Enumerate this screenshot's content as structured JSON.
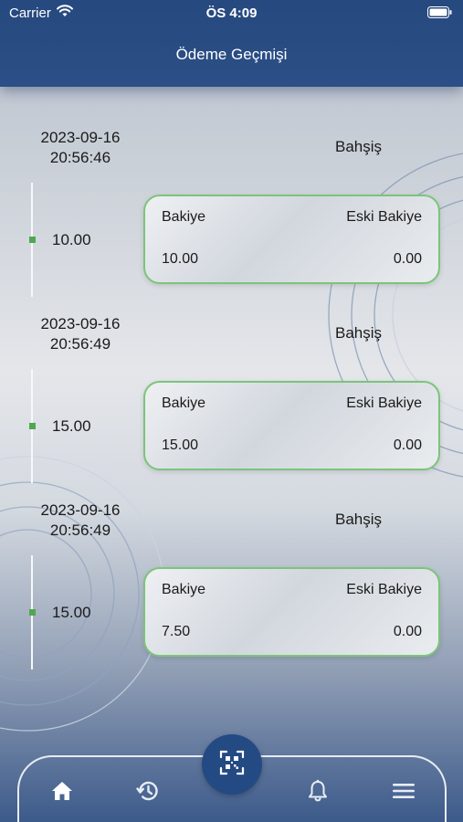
{
  "status_bar": {
    "carrier": "Carrier",
    "time": "ÖS 4:09"
  },
  "header": {
    "title": "Ödeme Geçmişi"
  },
  "entries": [
    {
      "date": "2023-09-16",
      "time": "20:56:46",
      "type": "Bahşiş",
      "amount": "10.00",
      "balance_label": "Bakiye",
      "old_balance_label": "Eski Bakiye",
      "balance": "10.00",
      "old_balance": "0.00"
    },
    {
      "date": "2023-09-16",
      "time": "20:56:49",
      "type": "Bahşiş",
      "amount": "15.00",
      "balance_label": "Bakiye",
      "old_balance_label": "Eski Bakiye",
      "balance": "15.00",
      "old_balance": "0.00"
    },
    {
      "date": "2023-09-16",
      "time": "20:56:49",
      "type": "Bahşiş",
      "amount": "15.00",
      "balance_label": "Bakiye",
      "old_balance_label": "Eski Bakiye",
      "balance": "7.50",
      "old_balance": "0.00"
    }
  ],
  "tab_bar": {
    "items": [
      {
        "icon": "home-icon"
      },
      {
        "icon": "history-icon"
      },
      {
        "icon": "qr-code-icon"
      },
      {
        "icon": "bell-icon"
      },
      {
        "icon": "menu-icon"
      }
    ]
  },
  "colors": {
    "header": "#26497f",
    "accent_green": "#4fa84f",
    "card_border": "#7cc47a",
    "qr_button": "#244a84"
  }
}
